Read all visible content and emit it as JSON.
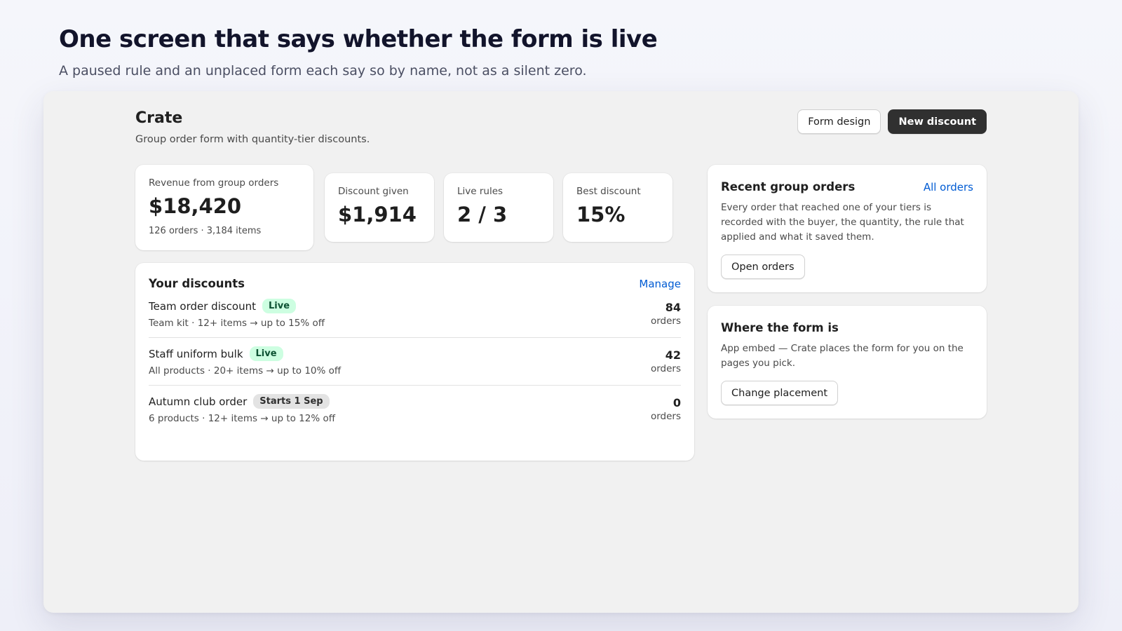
{
  "hero": {
    "title": "One screen that says whether the form is live",
    "subtitle": "A paused rule and an unplaced form each say so by name, not as a silent zero."
  },
  "app": {
    "title": "Crate",
    "subtitle": "Group order form with quantity-tier discounts.",
    "actions": {
      "form_design": "Form design",
      "new_discount": "New discount"
    }
  },
  "stats": [
    {
      "label": "Revenue from group orders",
      "value": "$18,420",
      "foot": "126 orders · 3,184 items"
    },
    {
      "label": "Discount given",
      "value": "$1,914"
    },
    {
      "label": "Live rules",
      "value": "2 / 3"
    },
    {
      "label": "Best discount",
      "value": "15%"
    }
  ],
  "discounts": {
    "title": "Your discounts",
    "manage_label": "Manage",
    "rows": [
      {
        "name": "Team order discount",
        "badge": "Live",
        "desc": "Team kit · 12+ items → up to 15% off",
        "count": "84",
        "unit": "orders"
      },
      {
        "name": "Staff uniform bulk",
        "badge": "Live",
        "desc": "All products · 20+ items → up to 10% off",
        "count": "42",
        "unit": "orders"
      },
      {
        "name": "Autumn club order",
        "badge": "Starts 1 Sep",
        "desc": "6 products · 12+ items → up to 12% off",
        "count": "0",
        "unit": "orders"
      }
    ]
  },
  "recent": {
    "title": "Recent group orders",
    "link": "All orders",
    "text": "Every order that reached one of your tiers is recorded with the buyer, the quantity, the rule that applied and what it saved them.",
    "button": "Open orders"
  },
  "placement": {
    "title": "Where the form is",
    "text": "App embed — Crate places the form for you on the pages you pick.",
    "button": "Change placement"
  },
  "colors": {
    "accent_link": "#005bd3",
    "primary_button": "#303030",
    "live_badge_bg": "#cdfee1",
    "live_badge_text": "#0c5132"
  }
}
